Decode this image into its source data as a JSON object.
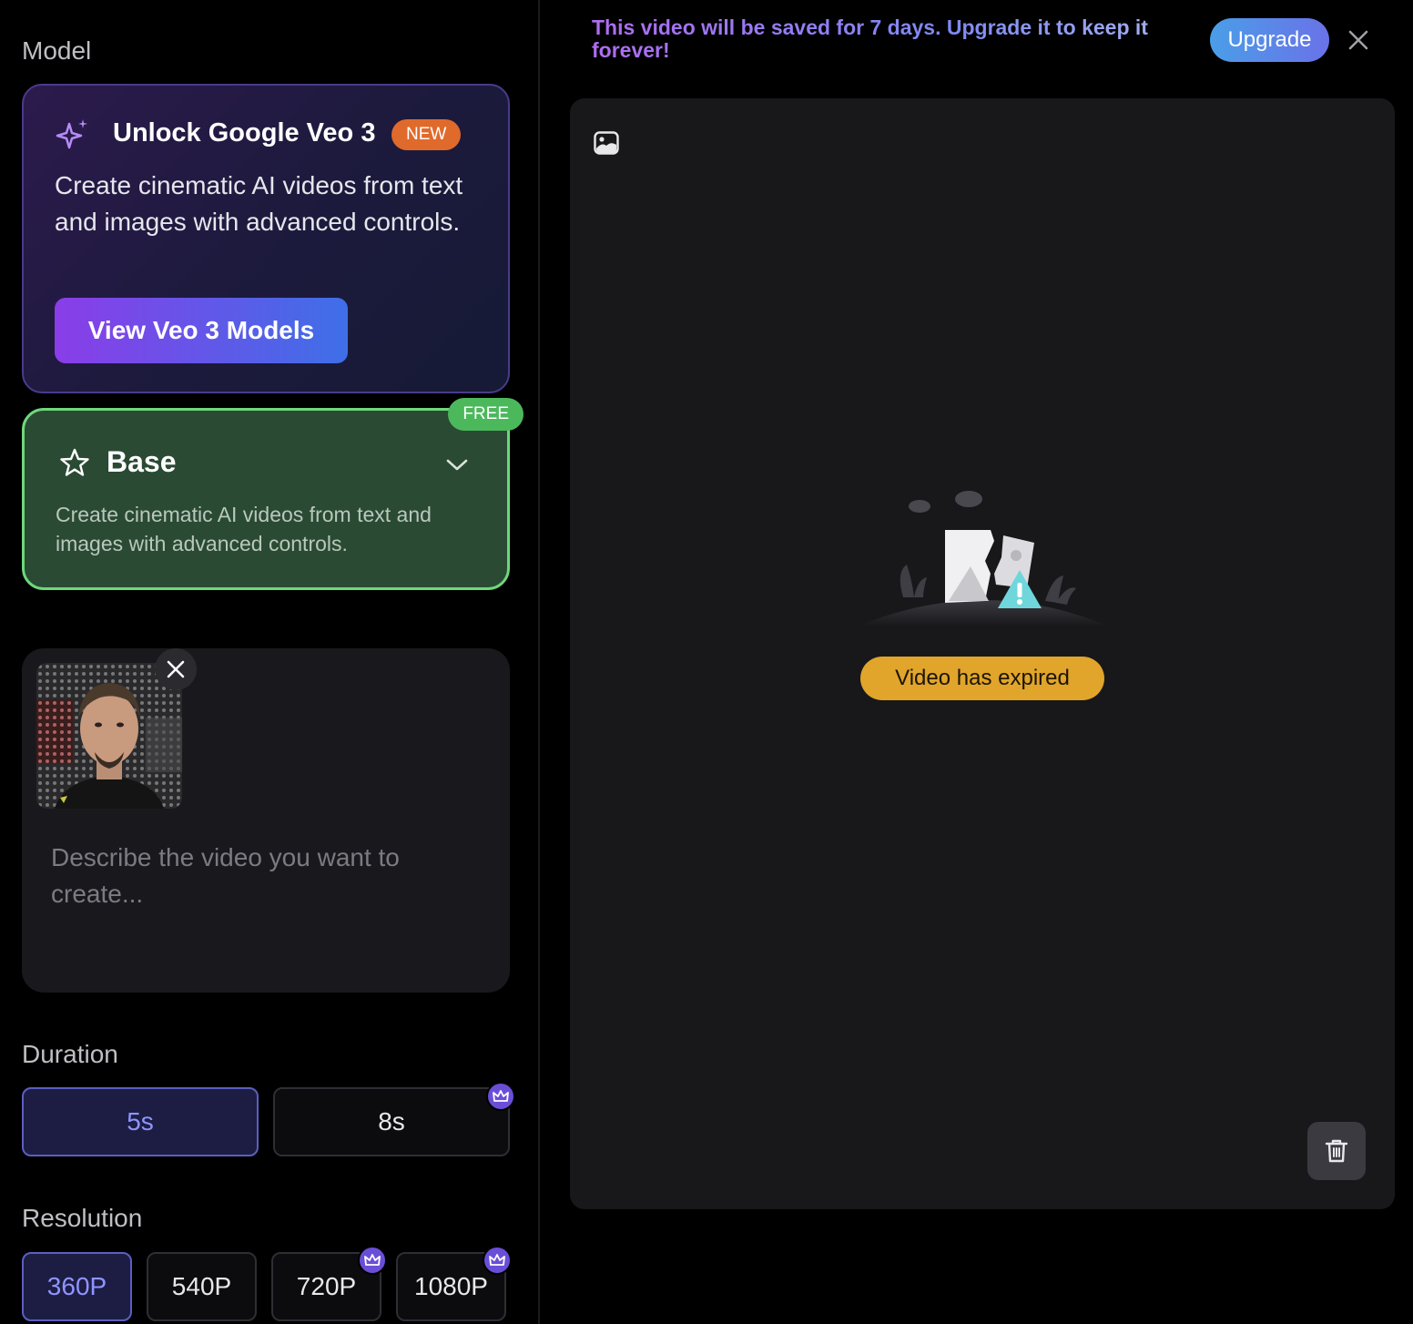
{
  "model": {
    "section_label": "Model",
    "promo": {
      "title": "Unlock Google Veo 3",
      "badge": "NEW",
      "description": "Create cinematic AI videos from text and images with advanced controls.",
      "button_label": "View Veo 3 Models",
      "icon": "sparkle-icon"
    },
    "selected": {
      "title": "Base",
      "badge": "FREE",
      "description": "Create cinematic AI videos from text and images with advanced controls.",
      "icon": "star-icon"
    }
  },
  "prompt": {
    "placeholder": "Describe the video you want to create...",
    "value": ""
  },
  "duration": {
    "section_label": "Duration",
    "options": [
      {
        "label": "5s",
        "selected": true,
        "premium": false
      },
      {
        "label": "8s",
        "selected": false,
        "premium": true
      }
    ]
  },
  "resolution": {
    "section_label": "Resolution",
    "options": [
      {
        "label": "360P",
        "selected": true,
        "premium": false
      },
      {
        "label": "540P",
        "selected": false,
        "premium": false
      },
      {
        "label": "720P",
        "selected": false,
        "premium": true
      },
      {
        "label": "1080P",
        "selected": false,
        "premium": true
      }
    ]
  },
  "banner": {
    "text": "This video will be saved for 7 days. Upgrade it to keep it forever!",
    "upgrade_label": "Upgrade"
  },
  "preview": {
    "status": "Video has expired"
  },
  "colors": {
    "accent_purple": "#8a3de8",
    "accent_blue": "#3e6fe8",
    "free_green": "#4cb85c",
    "new_orange": "#e06a2b",
    "expired_amber": "#e0a52a"
  }
}
